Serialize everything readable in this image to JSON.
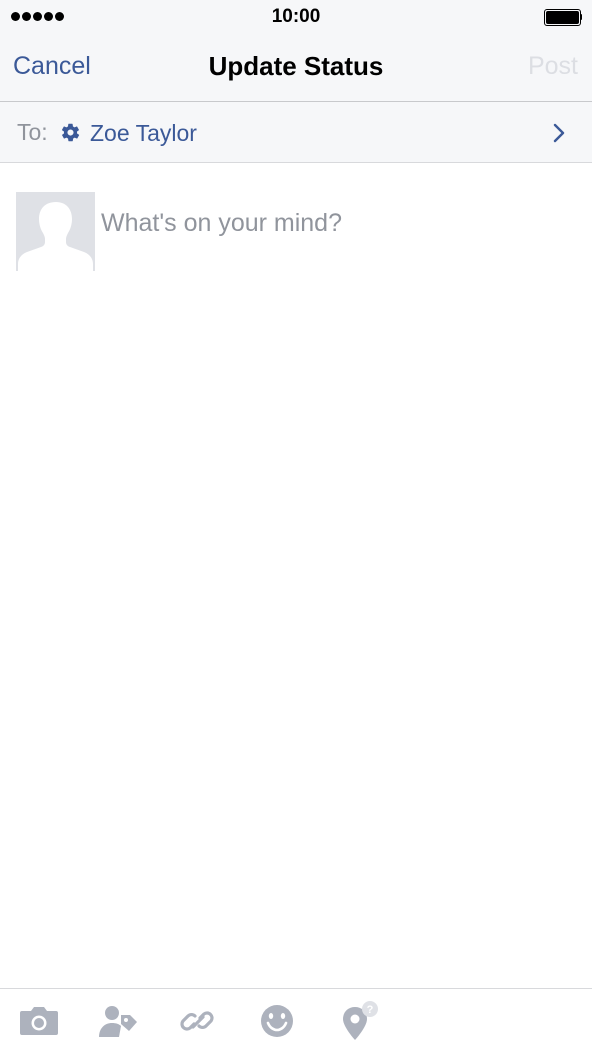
{
  "status_bar": {
    "time": "10:00"
  },
  "nav": {
    "cancel_label": "Cancel",
    "title": "Update Status",
    "post_label": "Post"
  },
  "audience": {
    "to_label": "To:",
    "name": "Zoe Taylor",
    "icon": "gear-icon",
    "chevron": "chevron-right-icon"
  },
  "composer": {
    "placeholder": "What's on your mind?",
    "value": ""
  },
  "toolbar": {
    "items": [
      {
        "icon": "camera-icon"
      },
      {
        "icon": "tag-people-icon"
      },
      {
        "icon": "link-icon"
      },
      {
        "icon": "emoji-icon"
      },
      {
        "icon": "check-in-icon"
      }
    ]
  },
  "colors": {
    "brand": "#3b5998",
    "muted_text": "#90949c",
    "disabled": "#dcdee3",
    "bar_background": "#f6f7f9",
    "icon_gray": "#adb2bd"
  }
}
